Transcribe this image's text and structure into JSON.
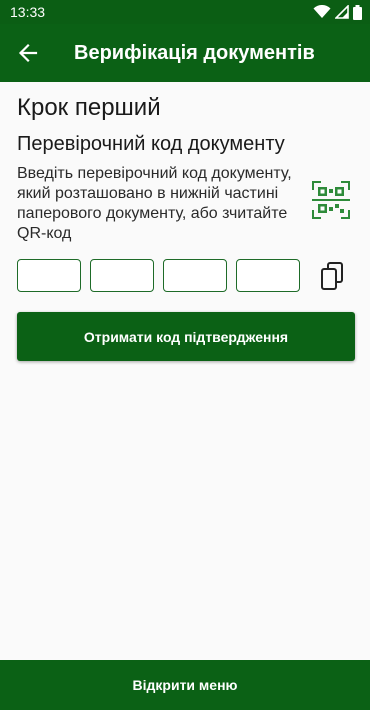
{
  "status_bar": {
    "time": "13:33"
  },
  "app_bar": {
    "title": "Верифікація документів"
  },
  "main": {
    "step_title": "Крок перший",
    "section_title": "Перевірочний код документу",
    "instruction": "Введіть перевірочний код документу, який розташовано в нижній частині паперового документу, або зчитайте QR-код",
    "code_fields": [
      {
        "value": "",
        "placeholder": ""
      },
      {
        "value": "",
        "placeholder": ""
      },
      {
        "value": "",
        "placeholder": ""
      },
      {
        "value": "",
        "placeholder": ""
      }
    ],
    "submit_label": "Отримати код підтвердження"
  },
  "bottom_bar": {
    "menu_label": "Відкрити меню"
  },
  "icons": {
    "back": "arrow-left-icon",
    "qr": "qr-code-scan-icon",
    "copy": "copy-icon",
    "wifi": "wifi-icon",
    "signal": "signal-icon",
    "battery": "battery-icon"
  },
  "colors": {
    "primary": "#0b6115",
    "status_bar": "#0b5e14",
    "field_border": "#1e6b28",
    "background": "#fafafa"
  }
}
